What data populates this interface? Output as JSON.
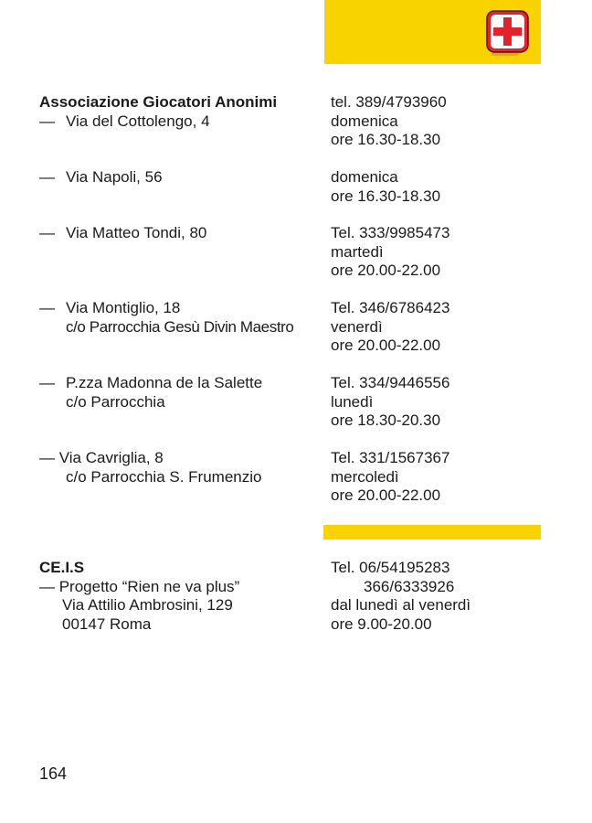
{
  "header": {
    "icon": "first-aid-box-icon",
    "accent_color": "#f9d300",
    "cross_color": "#e3222b"
  },
  "entries": [
    {
      "left": [
        "Associazione Giocatori Anonimi",
        "Via del Cottolengo, 4"
      ],
      "right": [
        "tel. 389/4793960",
        "domenica",
        "ore 16.30-18.30"
      ]
    },
    {
      "left": [
        "Via Napoli, 56"
      ],
      "right": [
        "domenica",
        "ore 16.30-18.30"
      ]
    },
    {
      "left": [
        "Via Matteo Tondi, 80"
      ],
      "right": [
        "Tel. 333/9985473",
        "martedì",
        "ore 20.00-22.00"
      ]
    },
    {
      "left": [
        "Via Montiglio, 18",
        "c/o Parrocchia Gesù Divin Maestro"
      ],
      "right": [
        "Tel. 346/6786423",
        "venerdì",
        "ore 20.00-22.00"
      ]
    },
    {
      "left": [
        "P.zza Madonna de la Salette",
        "c/o Parrocchia"
      ],
      "right": [
        "Tel. 334/9446556",
        "lunedì",
        "ore 18.30-20.30"
      ]
    },
    {
      "left": [
        "— Via Cavriglia, 8",
        "c/o Parrocchia S. Frumenzio"
      ],
      "right": [
        "Tel. 331/1567367",
        "mercoledì",
        "ore 20.00-22.00"
      ]
    }
  ],
  "ceis": {
    "left": [
      "CE.I.S",
      "— Progetto “Rien ne va plus”",
      "Via Attilio Ambrosini, 129",
      "00147 Roma"
    ],
    "right": [
      "Tel. 06/54195283",
      "366/6333926",
      "dal lunedì al venerdì",
      "ore 9.00-20.00"
    ]
  },
  "dash": "—",
  "page_number": "164"
}
